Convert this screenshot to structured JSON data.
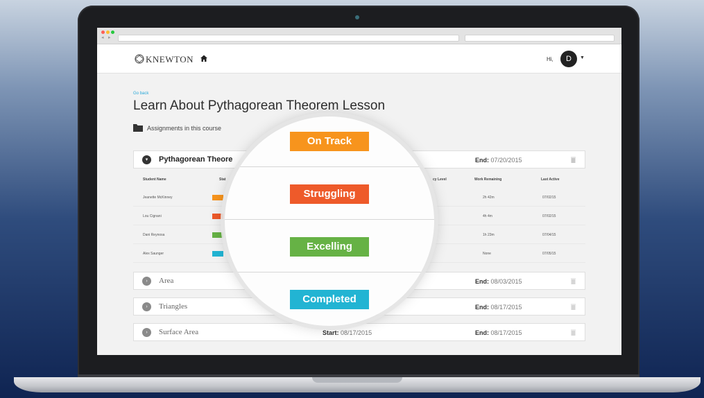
{
  "app": {
    "brand": "KNEWTON",
    "greeting": "Hi,",
    "user_initial": "D"
  },
  "page": {
    "back_link": "Go back",
    "title": "Learn About Pythagorean Theorem Lesson",
    "assignments_label": "Assignments in this course"
  },
  "active_assignment": {
    "title": "Pythagorean Theore",
    "end_label": "End:",
    "end_date": "07/20/2015"
  },
  "table": {
    "headers": [
      "Student Name",
      "Stat",
      "cy Level",
      "Work Remaining",
      "Last Active"
    ],
    "rows": [
      {
        "name": "Jeanette McKinney",
        "remaining": "2h 42m",
        "last_active": "07/02/15",
        "status_color": "#f7941d"
      },
      {
        "name": "Lou Cignani",
        "remaining": "4h 4m",
        "last_active": "07/02/15",
        "status_color": "#ee5a2a"
      },
      {
        "name": "Dani Reynosa",
        "remaining": "1h 23m",
        "last_active": "07/04/15",
        "status_color": "#66b245"
      },
      {
        "name": "Alex Saunger",
        "remaining": "None",
        "last_active": "07/05/15",
        "status_color": "#22b4d3"
      }
    ]
  },
  "assignments": [
    {
      "title": "Area",
      "start_label": "",
      "start_date": "",
      "end_label": "End:",
      "end_date": "08/03/2015"
    },
    {
      "title": "Triangles",
      "start_label": "",
      "start_date": "",
      "end_label": "End:",
      "end_date": "08/17/2015"
    },
    {
      "title": "Surface Area",
      "start_label": "Start:",
      "start_date": "08/17/2015",
      "end_label": "End:",
      "end_date": "08/17/2015"
    }
  ],
  "status_badges": [
    {
      "label": "On Track",
      "color": "#f7941d"
    },
    {
      "label": "Struggling",
      "color": "#ee5a2a"
    },
    {
      "label": "Excelling",
      "color": "#66b245"
    },
    {
      "label": "Completed",
      "color": "#22b4d3"
    }
  ]
}
